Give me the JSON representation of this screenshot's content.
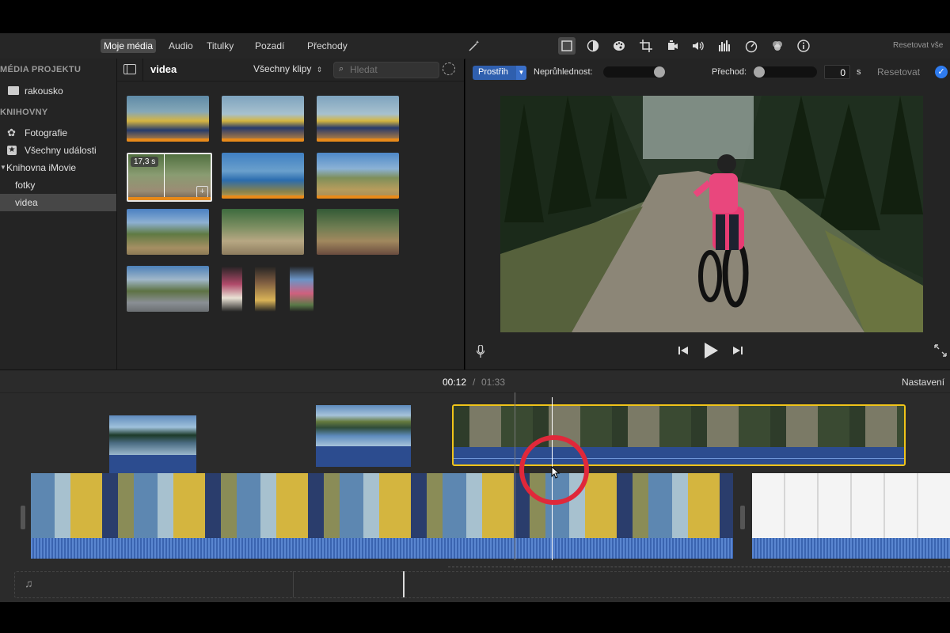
{
  "tabs": [
    {
      "label": "Moje média",
      "active": true
    },
    {
      "label": "Audio",
      "active": false
    },
    {
      "label": "Titulky",
      "active": false
    },
    {
      "label": "Pozadí",
      "active": false
    },
    {
      "label": "Přechody",
      "active": false
    }
  ],
  "toolbar": {
    "reset_all": "Resetovat vše",
    "icons": [
      "magic-wand-icon",
      "crop-to-fill-icon",
      "color-balance-icon",
      "color-palette-icon",
      "crop-icon",
      "stabilization-icon",
      "volume-icon",
      "equalizer-icon",
      "speed-icon",
      "filter-icon",
      "info-icon"
    ]
  },
  "inspector": {
    "transition_style": "Prostřih",
    "opacity_label": "Neprůhlednost:",
    "transition_label": "Přechod:",
    "transition_value": "0",
    "transition_unit": "s",
    "reset_label": "Resetovat"
  },
  "sidebar": {
    "project_header": "MÉDIA PROJEKTU",
    "project_item": "rakousko",
    "libraries_header": "KNIHOVNY",
    "items": [
      {
        "label": "Fotografie",
        "icon": "photos-icon"
      },
      {
        "label": "Všechny události",
        "icon": "star-icon"
      },
      {
        "label": "Knihovna iMovie",
        "icon": "disclosure-triangle-icon"
      },
      {
        "label": "fotky",
        "icon": ""
      },
      {
        "label": "videa",
        "icon": "",
        "selected": true
      }
    ]
  },
  "browser": {
    "title": "videa",
    "filter": "Všechny klipy",
    "search_placeholder": "Hledat",
    "selected_duration": "17,3 s"
  },
  "timeline": {
    "current_time": "00:12",
    "separator": "/",
    "total_time": "01:33",
    "settings_label": "Nastavení"
  }
}
